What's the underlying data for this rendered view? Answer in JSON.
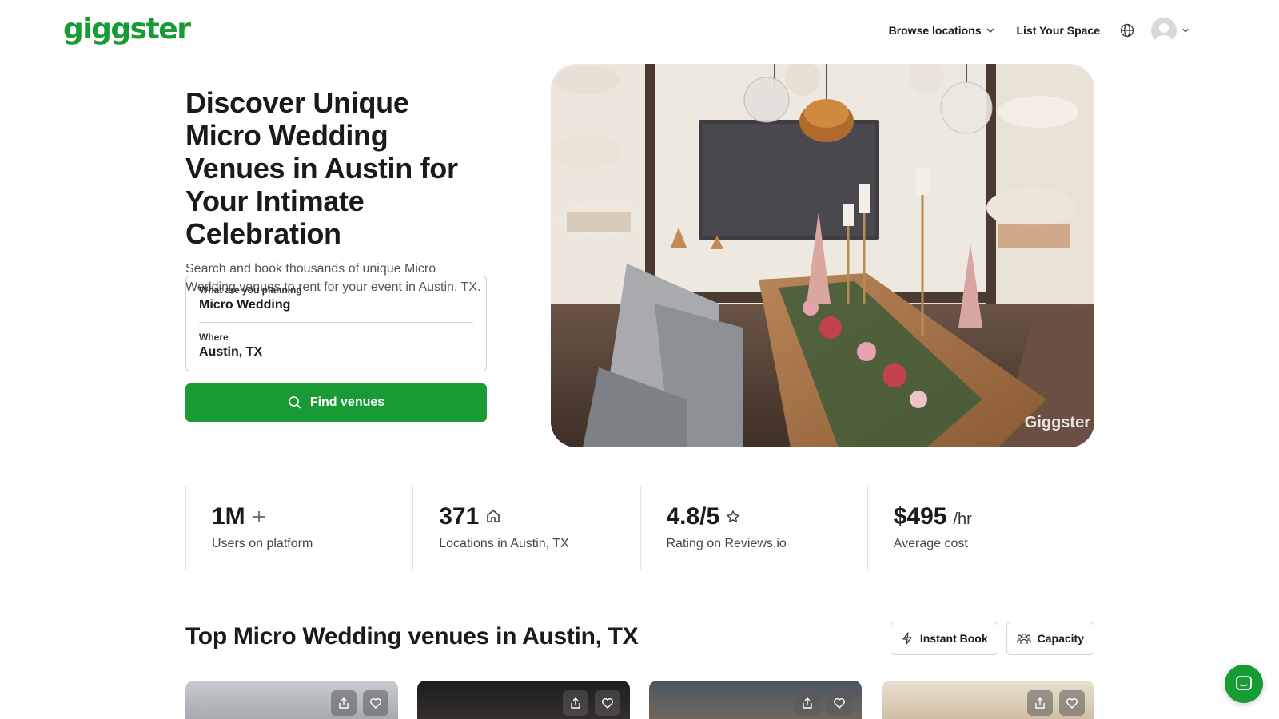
{
  "header": {
    "logo_text": "giggster",
    "browse_label": "Browse locations",
    "list_space_label": "List Your Space"
  },
  "hero": {
    "title": "Discover Unique Micro Wedding Venues in Austin for Your Intimate Celebration",
    "subtitle": "Search and book thousands of unique Micro Wedding venues to rent for your event in Austin, TX.",
    "search": {
      "planning_label": "What are you planning",
      "planning_value": "Micro Wedding",
      "where_label": "Where",
      "where_value": "Austin, TX"
    },
    "find_button_label": "Find venues",
    "image_watermark": "Giggster"
  },
  "stats": [
    {
      "value": "1M",
      "suffix": "+",
      "label": "Users on platform",
      "icon": "plus-icon"
    },
    {
      "value": "371",
      "suffix": "",
      "label": "Locations in Austin, TX",
      "icon": "home-icon"
    },
    {
      "value": "4.8/5",
      "suffix": "",
      "label": "Rating on Reviews.io",
      "icon": "star-icon"
    },
    {
      "value": "$495",
      "suffix": "/hr",
      "label": "Average cost",
      "icon": ""
    }
  ],
  "section": {
    "title": "Top Micro Wedding venues in Austin, TX",
    "filters": [
      {
        "label": "Instant Book",
        "icon": "lightning-icon"
      },
      {
        "label": "Capacity",
        "icon": "people-icon"
      }
    ]
  },
  "colors": {
    "brand_green": "#189a35",
    "text_dark": "#1a1a1a"
  }
}
